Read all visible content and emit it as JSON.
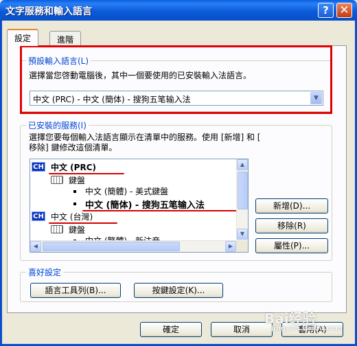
{
  "window": {
    "title": "文字服務和輸入語言",
    "help_label": "?",
    "close_label": "✕"
  },
  "tabs": [
    {
      "label": "設定",
      "active": true
    },
    {
      "label": "進階",
      "active": false
    }
  ],
  "default_language": {
    "legend": "預設輸入語言(L)",
    "description": "選擇當您啓動電腦後，其中一個要使用的已安裝輸入法語言。",
    "selected": "中文 (PRC) - 中文 (簡体) - 搜狗五笔输入法"
  },
  "installed_services": {
    "legend": "已安裝的服務(I)",
    "description_line1": "選擇您要每個輸入法語言顯示在清單中的服務。使用 [新增] 和 [",
    "description_line2": "移除] 鍵修改這個清單。",
    "tree": {
      "lang1_code": "CH",
      "lang1_name": "中文 (PRC)",
      "lang1_keyboard": "鍵盤",
      "lang1_item1": "中文 (簡體) - 美式鍵盤",
      "lang1_item2": "中文 (簡体) - 搜狗五笔输入法",
      "lang2_code": "CH",
      "lang2_name": "中文 (台灣)",
      "lang2_keyboard": "鍵盤",
      "lang2_item1": "中文 (繁體) - 新注音"
    },
    "buttons": {
      "add": "新增(D)...",
      "remove": "移除(R)",
      "properties": "屬性(P)..."
    }
  },
  "preferences": {
    "legend": "喜好設定",
    "language_bar": "語言工具列(B)...",
    "key_settings": "按鍵設定(K)..."
  },
  "footer": {
    "ok": "確定",
    "cancel": "取消",
    "apply": "套用(A)"
  },
  "watermark": {
    "text": "Bai经验",
    "sub": "jingyan.baidu.com"
  }
}
